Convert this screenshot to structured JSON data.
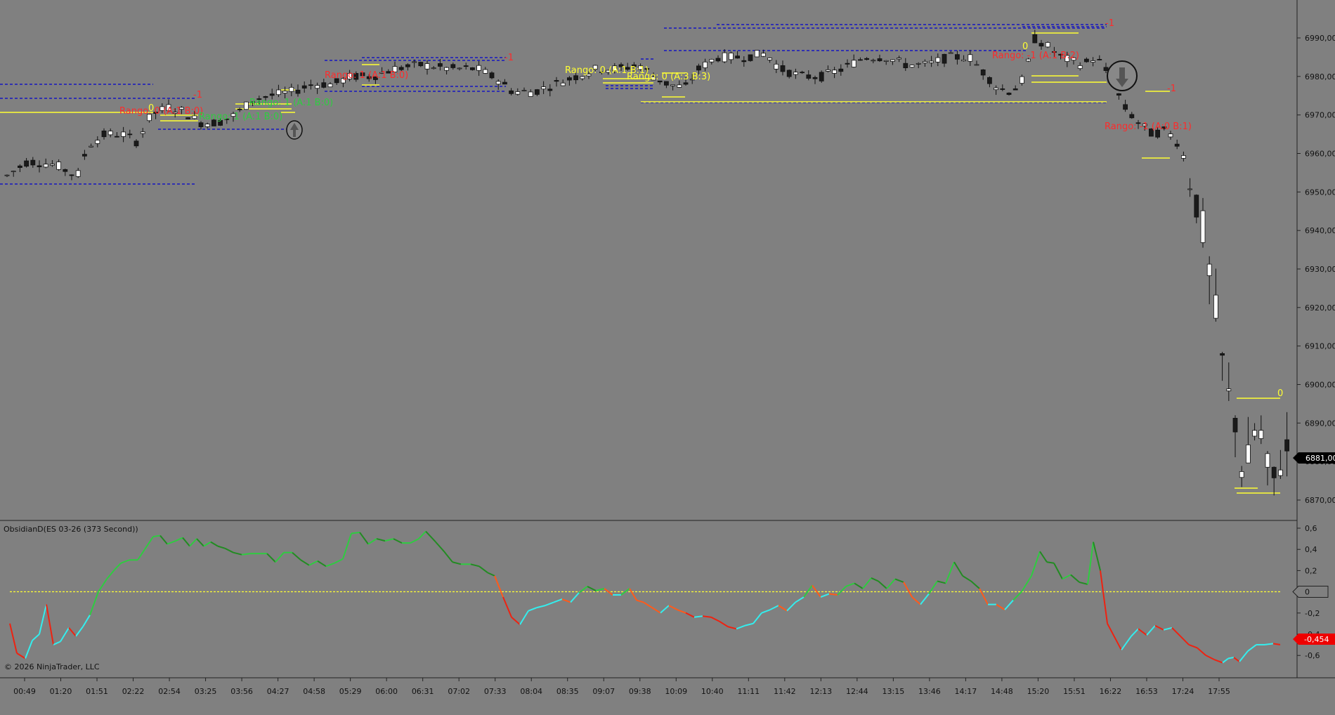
{
  "indicator": {
    "title": "ObsidianD(ES 03-26 (373 Second))",
    "ticks": [
      "0,6",
      "0,4",
      "0,2",
      "0",
      "-0,2",
      "-0,4",
      "-0,6"
    ],
    "current_value": "-0,454",
    "zero_marker": "0"
  },
  "price_axis": {
    "ticks": [
      "6990,00",
      "6980,00",
      "6970,00",
      "6960,00",
      "6950,00",
      "6940,00",
      "6930,00",
      "6920,00",
      "6910,00",
      "6900,00",
      "6890,00",
      "6880,00",
      "6870,00"
    ],
    "current_price": "6881,00"
  },
  "time_axis": {
    "labels": [
      "00:49",
      "01:20",
      "01:51",
      "02:22",
      "02:54",
      "03:25",
      "03:56",
      "04:27",
      "04:58",
      "05:29",
      "06:00",
      "06:31",
      "07:02",
      "07:33",
      "08:04",
      "08:35",
      "09:07",
      "09:38",
      "10:09",
      "10:40",
      "11:11",
      "11:42",
      "12:13",
      "12:44",
      "13:15",
      "13:46",
      "14:17",
      "14:48",
      "15:20",
      "15:51",
      "16:22",
      "16:53",
      "17:24",
      "17:55"
    ]
  },
  "annotations": [
    {
      "text": "Rango: 0 (A:1 B:0)",
      "color": "#ff2a2a"
    },
    {
      "text": "0",
      "color": "#ffff33"
    },
    {
      "text": "-1",
      "color": "#ff2a2a"
    },
    {
      "text": "Rango: 1 (A:1 B:0)",
      "color": "#2ecc40"
    },
    {
      "text": "Rango: 1 (A:1 B:0)",
      "color": "#2ecc40"
    },
    {
      "text": "Rango: 1 (A:1 B:0)",
      "color": "#ff2a2a"
    },
    {
      "text": "-1",
      "color": "#ff2a2a"
    },
    {
      "text": "Rango: 0 (A:1 B:1)",
      "color": "#ffff33"
    },
    {
      "text": "Rango: 0 (A:3 B:3)",
      "color": "#ffff33"
    },
    {
      "text": "Rango: -1 (A:1 B:2)",
      "color": "#ff2a2a"
    },
    {
      "text": "0",
      "color": "#ffff33"
    },
    {
      "text": "-1",
      "color": "#ff2a2a"
    },
    {
      "text": "-1",
      "color": "#ff2a2a"
    },
    {
      "text": "Rango: -1 (A:0 B:1)",
      "color": "#ff2a2a"
    },
    {
      "text": "0",
      "color": "#ffff33"
    }
  ],
  "copyright": "© 2026 NinjaTrader, LLC",
  "colors": {
    "background": "#808080",
    "up_candle": "#ffffff",
    "down_candle": "#1a1a1a",
    "dashed_level": "#0000cc",
    "yellow_level": "#ffff33",
    "indicator_green": "#2ecc40",
    "indicator_dark_green": "#228b22",
    "indicator_cyan": "#33eeee",
    "indicator_red": "#ee2211",
    "indicator_orange": "#ff5a1a"
  },
  "signals": [
    {
      "name": "up-arrow",
      "icon": "arrow-up-icon"
    },
    {
      "name": "down-arrow",
      "icon": "arrow-down-icon"
    }
  ]
}
